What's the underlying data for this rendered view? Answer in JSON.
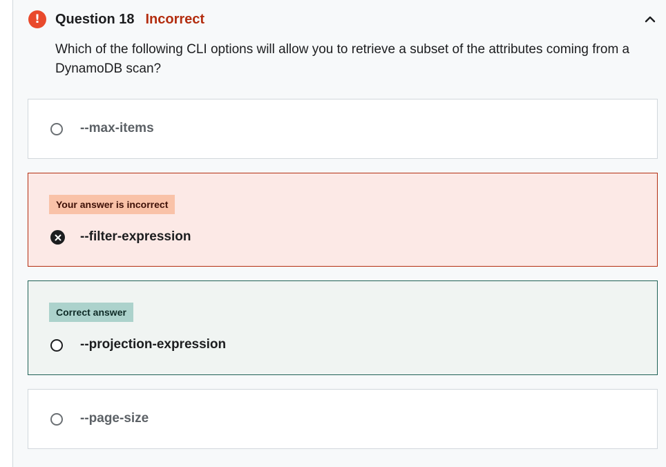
{
  "question": {
    "title": "Question 18",
    "status": "Incorrect",
    "text": "Which of the following CLI options will allow you to retrieve a subset of the attributes coming from a DynamoDB scan?",
    "alert_icon": "exclamation-icon",
    "collapse_icon": "chevron-up-icon"
  },
  "options": [
    {
      "label": "--max-items",
      "state": "neutral"
    },
    {
      "label": "--filter-expression",
      "state": "selected-incorrect",
      "badge": "Your answer is incorrect"
    },
    {
      "label": "--projection-expression",
      "state": "correct",
      "badge": "Correct answer"
    },
    {
      "label": "--page-size",
      "state": "neutral"
    }
  ],
  "colors": {
    "incorrect_accent": "#b32d0f",
    "incorrect_bg": "#fce9e6",
    "correct_accent": "#1e6055",
    "correct_bg": "#f0f4f2",
    "alert": "#e94a2c"
  }
}
